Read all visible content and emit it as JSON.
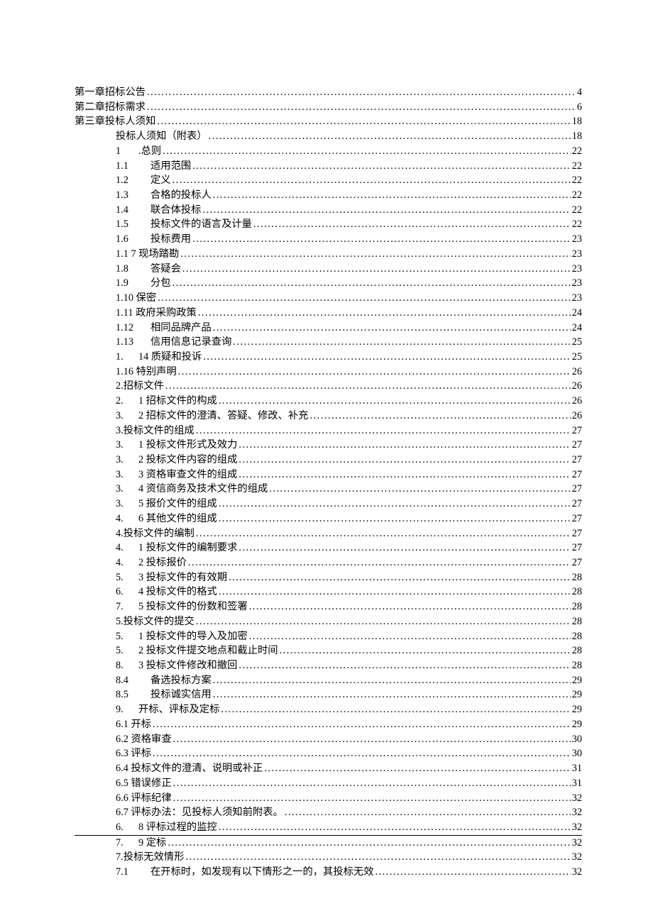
{
  "toc": [
    {
      "indent": 1,
      "num": "",
      "numClass": "w1",
      "title": "第一章招标公告",
      "page": "4",
      "underline": false
    },
    {
      "indent": 1,
      "num": "",
      "numClass": "w1",
      "title": "第二章招标需求",
      "page": "6",
      "underline": false
    },
    {
      "indent": 1,
      "num": "",
      "numClass": "w1",
      "title": "第三章投标人须知",
      "page": "18",
      "underline": false
    },
    {
      "indent": 2,
      "num": "",
      "numClass": "w1",
      "title": "投标人须知（附表）",
      "page": "18",
      "underline": false
    },
    {
      "indent": 2,
      "num": "1",
      "numClass": "w3",
      "title": ".总则",
      "page": "22",
      "underline": false
    },
    {
      "indent": 2,
      "num": "1.1",
      "numClass": "w2",
      "title": "适用范围",
      "page": "22",
      "underline": false
    },
    {
      "indent": 2,
      "num": "1.2",
      "numClass": "w2",
      "title": "定义",
      "page": "22",
      "underline": false
    },
    {
      "indent": 2,
      "num": "1.3",
      "numClass": "w2",
      "title": "合格的投标人",
      "page": "22",
      "underline": false
    },
    {
      "indent": 2,
      "num": "1.4",
      "numClass": "w2",
      "title": "联合体投标",
      "page": "22",
      "underline": false
    },
    {
      "indent": 2,
      "num": "1.5",
      "numClass": "w2",
      "title": "投标文件的语言及计量",
      "page": "22",
      "underline": false
    },
    {
      "indent": 2,
      "num": "1.6",
      "numClass": "w2",
      "title": "投标费用",
      "page": "23",
      "underline": false
    },
    {
      "indent": 2,
      "num": "1.1 7 现场踏勘",
      "numClass": "w1",
      "title": "",
      "page": "23",
      "underline": false
    },
    {
      "indent": 2,
      "num": "1.8",
      "numClass": "w2",
      "title": "答疑会",
      "page": "23",
      "underline": false
    },
    {
      "indent": 2,
      "num": "1.9",
      "numClass": "w2",
      "title": "分包",
      "page": "23",
      "underline": false
    },
    {
      "indent": 2,
      "num": "1.10 保密",
      "numClass": "w1",
      "title": "",
      "page": "23",
      "underline": false
    },
    {
      "indent": 2,
      "num": "1.11 政府采购政策",
      "numClass": "w1",
      "title": "",
      "page": "24",
      "underline": false
    },
    {
      "indent": 2,
      "num": "1.12",
      "numClass": "w2",
      "title": " 相同品牌产品",
      "page": "24",
      "underline": false
    },
    {
      "indent": 2,
      "num": "1.13",
      "numClass": "w2",
      "title": " 信用信息记录查询",
      "page": "25",
      "underline": false
    },
    {
      "indent": 2,
      "num": "1.",
      "numClass": "w3",
      "title": "14 质疑和投诉",
      "page": "25",
      "underline": false
    },
    {
      "indent": 2,
      "num": "1.16 特别声明",
      "numClass": "w1",
      "title": "",
      "page": "26",
      "underline": false
    },
    {
      "indent": 2,
      "num": "2.招标文件 ",
      "numClass": "w1",
      "title": "",
      "page": "26",
      "underline": false
    },
    {
      "indent": 2,
      "num": "2.",
      "numClass": "w3",
      "title": "1 招标文件的构成",
      "page": "26",
      "underline": false
    },
    {
      "indent": 2,
      "num": "3.",
      "numClass": "w3",
      "title": "2 招标文件的澄清、答疑、修改、补充",
      "page": "26",
      "underline": false
    },
    {
      "indent": 2,
      "num": "3.投标文件的组成 ",
      "numClass": "w1",
      "title": "",
      "page": "27",
      "underline": false
    },
    {
      "indent": 2,
      "num": "3.",
      "numClass": "w3",
      "title": "1 投标文件形式及效力",
      "page": "27",
      "underline": false
    },
    {
      "indent": 2,
      "num": "3.",
      "numClass": "w3",
      "title": "2 投标文件内容的组成",
      "page": "27",
      "underline": false
    },
    {
      "indent": 2,
      "num": "3.",
      "numClass": "w3",
      "title": "3 资格审查文件的组成",
      "page": "27",
      "underline": false
    },
    {
      "indent": 2,
      "num": "3.",
      "numClass": "w3",
      "title": "4 资信商务及技术文件的组成",
      "page": "27",
      "underline": false
    },
    {
      "indent": 2,
      "num": "3.",
      "numClass": "w3",
      "title": "5 报价文件的组成",
      "page": "27",
      "underline": false
    },
    {
      "indent": 2,
      "num": "4.",
      "numClass": "w3",
      "title": "6 其他文件的组成",
      "page": "27",
      "underline": false
    },
    {
      "indent": 2,
      "num": "4.投标文件的编制 ",
      "numClass": "w1",
      "title": "",
      "page": "27",
      "underline": false
    },
    {
      "indent": 2,
      "num": "4.",
      "numClass": "w3",
      "title": "1 投标文件的编制要求",
      "page": "27",
      "underline": false
    },
    {
      "indent": 2,
      "num": "4.",
      "numClass": "w3",
      "title": "2 投标报价",
      "page": "27",
      "underline": false
    },
    {
      "indent": 2,
      "num": "5.",
      "numClass": "w3",
      "title": "3 投标文件的有效期",
      "page": "28",
      "underline": false
    },
    {
      "indent": 2,
      "num": "6.",
      "numClass": "w3",
      "title": "4 投标文件的格式",
      "page": "28",
      "underline": false
    },
    {
      "indent": 2,
      "num": "7.",
      "numClass": "w3",
      "title": "5 投标文件的份数和签署",
      "page": "28",
      "underline": false
    },
    {
      "indent": 2,
      "num": "5.投标文件的提交 ",
      "numClass": "w1",
      "title": "",
      "page": "28",
      "underline": false
    },
    {
      "indent": 2,
      "num": "5.",
      "numClass": "w3",
      "title": "1 投标文件的导入及加密",
      "page": "28",
      "underline": false
    },
    {
      "indent": 2,
      "num": "5.",
      "numClass": "w3",
      "title": "2 投标文件提交地点和截止时间",
      "page": "28",
      "underline": false
    },
    {
      "indent": 2,
      "num": "8.",
      "numClass": "w3",
      "title": "3 投标文件修改和撤回",
      "page": "28",
      "underline": false
    },
    {
      "indent": 2,
      "num": "8.4",
      "numClass": "w2",
      "title": "备选投标方案",
      "page": "29",
      "underline": false
    },
    {
      "indent": 2,
      "num": "8.5",
      "numClass": "w2",
      "title": "投标诚实信用",
      "page": "29",
      "underline": false
    },
    {
      "indent": 2,
      "num": "9.",
      "numClass": "w3",
      "title": "开标、评标及定标",
      "page": "29",
      "underline": false
    },
    {
      "indent": 2,
      "num": "6.1 开标",
      "numClass": "w1",
      "title": "",
      "page": "29",
      "underline": false
    },
    {
      "indent": 2,
      "num": "6.2 资格审查",
      "numClass": "w1",
      "title": "",
      "page": "30",
      "underline": false
    },
    {
      "indent": 2,
      "num": "6.3 评标",
      "numClass": "w1",
      "title": "",
      "page": "30",
      "underline": false
    },
    {
      "indent": 2,
      "num": "6.4 投标文件的澄清、说明或补正",
      "numClass": "w1",
      "title": "",
      "page": "31",
      "underline": false
    },
    {
      "indent": 2,
      "num": "6.5 错误修正",
      "numClass": "w1",
      "title": "",
      "page": "31",
      "underline": false
    },
    {
      "indent": 2,
      "num": "6.6 评标纪律",
      "numClass": "w1",
      "title": "",
      "page": "32",
      "underline": false
    },
    {
      "indent": 2,
      "num": "6.7 评标办法：见投标人须知前附表。",
      "numClass": "w1",
      "title": "",
      "page": "32",
      "underline": false
    },
    {
      "indent": 2,
      "num": "6.",
      "numClass": "w3",
      "title": "8 评标过程的监控",
      "page": "32",
      "underline": true
    },
    {
      "indent": 2,
      "num": "7.",
      "numClass": "w3",
      "title": "9 定标",
      "page": "32",
      "underline": false
    },
    {
      "indent": 2,
      "num": "7.投标无效情形 ",
      "numClass": "w1",
      "title": "",
      "page": "32",
      "underline": false
    },
    {
      "indent": 2,
      "num": "7.1",
      "numClass": "w2",
      "title": "在开标时，如发现有以下情形之一的，其投标无效",
      "page": "32",
      "underline": false
    }
  ]
}
